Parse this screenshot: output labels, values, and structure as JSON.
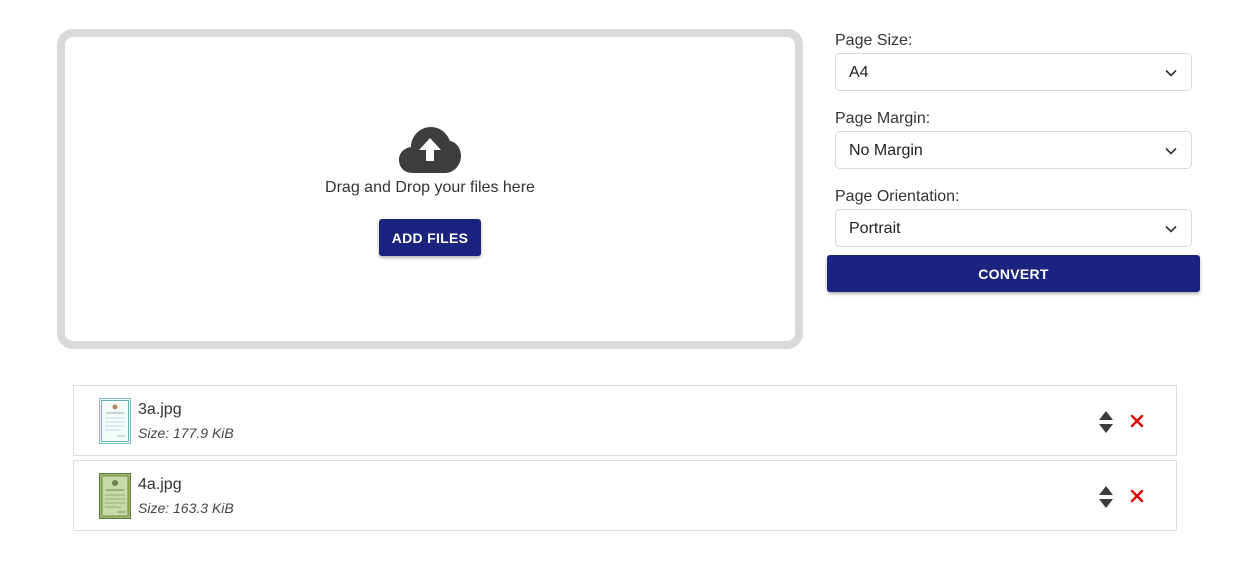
{
  "dropzone": {
    "upload_icon": "cloud-upload-icon",
    "text": "Drag and Drop your files here",
    "add_files_label": "ADD FILES"
  },
  "options": {
    "page_size": {
      "label": "Page Size:",
      "value": "A4"
    },
    "page_margin": {
      "label": "Page Margin:",
      "value": "No Margin"
    },
    "page_orientation": {
      "label": "Page Orientation:",
      "value": "Portrait"
    },
    "convert_label": "CONVERT"
  },
  "files": [
    {
      "name": "3a.jpg",
      "size": "Size: 177.9 KiB"
    },
    {
      "name": "4a.jpg",
      "size": "Size: 163.3 KiB"
    }
  ],
  "colors": {
    "button_bg": "#1a237e",
    "remove": "#e00000",
    "icon": "#3d3d3d"
  }
}
